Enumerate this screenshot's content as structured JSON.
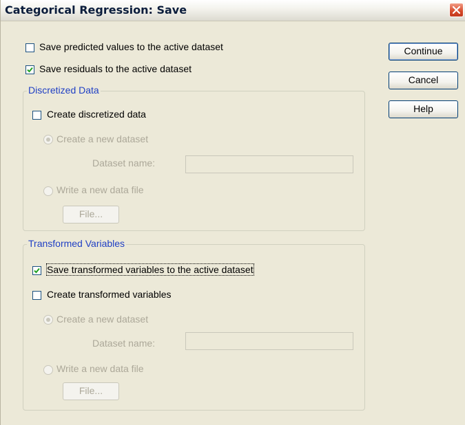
{
  "window": {
    "title": "Categorical Regression: Save"
  },
  "options": {
    "save_predicted": {
      "label": "Save predicted values to the active dataset",
      "checked": false
    },
    "save_residuals": {
      "label": "Save residuals to the active dataset",
      "checked": true
    }
  },
  "discretized": {
    "legend": "Discretized Data",
    "create_label": "Create discretized data",
    "create_checked": false,
    "new_dataset_label": "Create a new dataset",
    "dataset_name_label": "Dataset name:",
    "dataset_name_value": "",
    "write_file_label": "Write a new data file",
    "file_button": "File..."
  },
  "transformed": {
    "legend": "Transformed Variables",
    "save_label": "Save transformed variables to the active dataset",
    "save_checked": true,
    "create_label": "Create transformed variables",
    "create_checked": false,
    "new_dataset_label": "Create a new dataset",
    "dataset_name_label": "Dataset name:",
    "dataset_name_value": "",
    "write_file_label": "Write a new data file",
    "file_button": "File..."
  },
  "buttons": {
    "continue": "Continue",
    "cancel": "Cancel",
    "help": "Help"
  },
  "colors": {
    "title_text": "#0b1d3c",
    "group_legend": "#1f3fc4",
    "disabled_text": "#aca899",
    "background": "#ece9d8"
  },
  "icons": {
    "close": "close-icon",
    "check": "checkmark-icon",
    "radio": "radio-dot-icon"
  }
}
